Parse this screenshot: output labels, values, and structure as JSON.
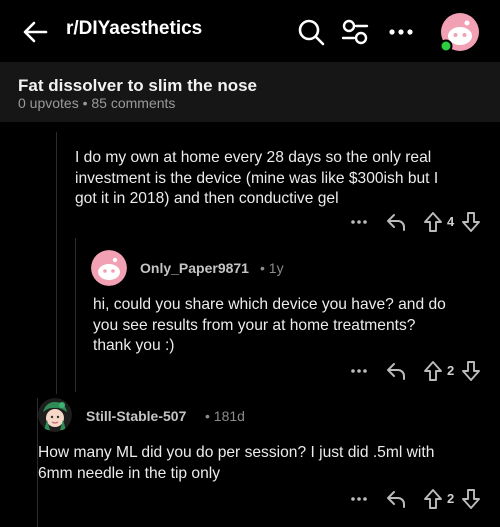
{
  "header": {
    "subreddit": "r/DIYaesthetics",
    "icons": [
      "back-arrow-icon",
      "search-icon",
      "filter-icon",
      "more-icon",
      "user-avatar"
    ]
  },
  "post": {
    "title": "Fat dissolver to slim the nose",
    "meta": "0 upvotes • 85 comments"
  },
  "comments": [
    {
      "author": "",
      "age": "",
      "lines": [
        "I do my own at home every 28 days so the only real",
        "investment is the device (mine was like $300ish but I",
        "got it in 2018) and then conductive gel"
      ],
      "votes": "4"
    },
    {
      "author": "Only_Paper9871",
      "age": "• 1y",
      "lines": [
        "hi, could you share which device you have? and do",
        "you see results from your at home treatments?",
        "thank you :)"
      ],
      "votes": "2"
    },
    {
      "author": "Still-Stable-507",
      "age": "• 181d",
      "lines": [
        "How many ML did you do per session? I just did .5ml with",
        "6mm needle in the tip only"
      ],
      "votes": "2"
    }
  ],
  "colors": {
    "background": "#000000",
    "post_header_bg": "#161616",
    "avatar_pink": "#f2a0b4",
    "online_green": "#2ecc40"
  }
}
